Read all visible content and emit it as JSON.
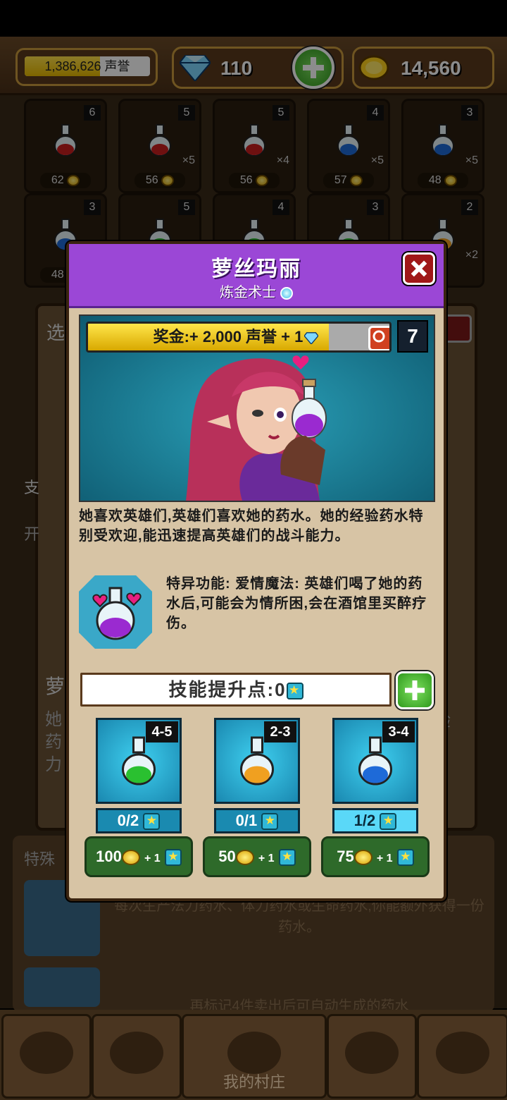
{
  "topbar": {
    "reputation_text": "1,386,626 声誉",
    "reputation_fill": 0.6,
    "gems": "110",
    "gold": "14,560"
  },
  "shelf": [
    {
      "count": "6",
      "price": "62",
      "mult": "",
      "color": "#c81e1e"
    },
    {
      "count": "5",
      "price": "56",
      "mult": "×5",
      "color": "#c81e1e"
    },
    {
      "count": "5",
      "price": "56",
      "mult": "×4",
      "color": "#c81e1e"
    },
    {
      "count": "4",
      "price": "57",
      "mult": "×5",
      "color": "#1e6ad8"
    },
    {
      "count": "3",
      "price": "48",
      "mult": "×5",
      "color": "#1e6ad8"
    },
    {
      "count": "3",
      "price": "48",
      "mult": "",
      "color": "#1e6ad8"
    },
    {
      "count": "5",
      "price": "",
      "mult": "",
      "color": "#2ac030"
    },
    {
      "count": "4",
      "price": "",
      "mult": "",
      "color": "#2ac030"
    },
    {
      "count": "3",
      "price": "",
      "mult": "",
      "color": "#2ac030"
    },
    {
      "count": "2",
      "price": "",
      "mult": "×2",
      "color": "#f0a020"
    }
  ],
  "background_text": {
    "left_1": "选",
    "left_2": "支",
    "left_3": "开",
    "left_4": "萝",
    "left_5": "她",
    "left_6": "药",
    "left_7": "力",
    "right_1": "验",
    "section_special": "特殊",
    "lower_desc_1": "每次生产法力药水、体力药水或生命药水,你能额外获得一份药水。",
    "lower_desc_2": "再标记4件卖出后可自动生成的药水"
  },
  "modal": {
    "title": "萝丝玛丽",
    "subtitle": "炼金术士",
    "bonus_text": "奖金:+ 2,000 声誉 + 1",
    "bonus_fill": 0.8,
    "level": "7",
    "description": "她喜欢英雄们,英雄们喜欢她的药水。她的经验药水特别受欢迎,能迅速提高英雄们的战斗能力。",
    "special": "特异功能: 爱情魔法: 英雄们喝了她的药水后,可能会为情所困,会在酒馆里买醉疗伤。",
    "skill_points_label": "技能提升点:0",
    "upgrades": [
      {
        "range": "4-5",
        "count": "0/2",
        "cost": "100",
        "cost_stars": "+ 1",
        "liquid": "#2ac030",
        "active": false
      },
      {
        "range": "2-3",
        "count": "0/1",
        "cost": "50",
        "cost_stars": "+ 1",
        "liquid": "#f0a020",
        "active": false
      },
      {
        "range": "3-4",
        "count": "1/2",
        "cost": "75",
        "cost_stars": "+ 1",
        "liquid": "#1e6ad8",
        "active": true
      }
    ]
  },
  "nav": {
    "village_label": "我的村庄"
  }
}
